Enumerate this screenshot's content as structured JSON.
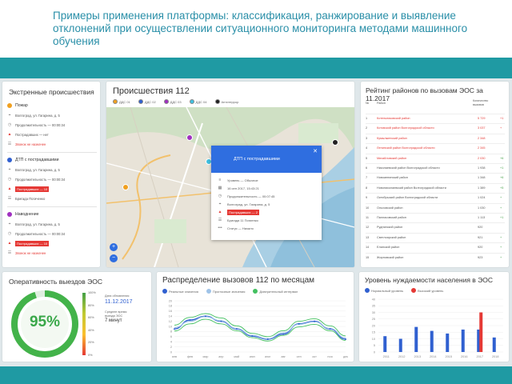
{
  "slide": {
    "title": "Примеры применения платформы: классификация, ранжирование и выявление отклонений при осуществлении ситуационного мониторинга методами машинного обучения"
  },
  "emergencies": {
    "title": "Экстренные происшествия",
    "incidents": [
      {
        "name": "Пожар",
        "color": "#f0a020",
        "address": "Волгоград, ул. Гагарина, д. 5",
        "duration": "Продолжительность — 00:00:34",
        "victims": "Пострадавших — нет",
        "status": "Звонок не назначен"
      },
      {
        "name": "ДТП с пострадавшими",
        "color": "#3060d0",
        "address": "Волгоград, ул. Гагарина, д. 5",
        "duration": "Продолжительность — 00:00:34",
        "victims": "Пострадавших — 10",
        "status": "Бригада Погиченко"
      },
      {
        "name": "Наводнение",
        "color": "#a030c0",
        "address": "Волгоград, ул. Гагарина, д. 5",
        "duration": "Продолжительность — 00:00:34",
        "victims": "Пострадавших — 10",
        "status": "Звонок не назначен"
      }
    ]
  },
  "map": {
    "title": "Происшествия 112",
    "legend": [
      {
        "label": "ДДС 01",
        "color": "#f0a020"
      },
      {
        "label": "ДДС 02",
        "color": "#3060d0"
      },
      {
        "label": "ДДС 03",
        "color": "#a030c0"
      },
      {
        "label": "ДДС 04",
        "color": "#40c0e0"
      },
      {
        "label": "Антитеррор",
        "color": "#222222"
      }
    ],
    "zoom_in": "+",
    "zoom_out": "−",
    "popup": {
      "title": "ДТП с пострадавшими",
      "close": "✕",
      "rows": [
        {
          "icon": "level-icon",
          "glyph": "≡",
          "text": "Уровень — Обычное"
        },
        {
          "icon": "calendar-icon",
          "glyph": "▦",
          "text": "16 сен 2017, 15:43:21"
        },
        {
          "icon": "clock-icon",
          "glyph": "◷",
          "text": "Продолжительность — 00:07:45"
        },
        {
          "icon": "location-icon",
          "glyph": "⌖",
          "text": "Волгоград, ул. Гагарина, д. 5"
        },
        {
          "icon": "warning-icon",
          "glyph": "▲",
          "text": "Пострадавших — 2",
          "alert": true
        },
        {
          "icon": "team-icon",
          "glyph": "☰",
          "text": "Бригада 11 Погиенко"
        },
        {
          "icon": "more-icon",
          "glyph": "•••",
          "text": "Статус — Начало"
        }
      ]
    }
  },
  "rating": {
    "title": "Рейтинг районов по вызовам ЭОС за 11.2017",
    "col_num": "№",
    "col_name": "Район",
    "col_value": "Количество вызовов",
    "rows": [
      {
        "num": "1",
        "name": "Котельниковский район",
        "value": "5 729",
        "delta": "+1",
        "red": true,
        "delta_color": "#e53935"
      },
      {
        "num": "2",
        "name": "Котовский район Волгоградской области",
        "value": "3 037",
        "delta": "+",
        "red": true,
        "delta_color": "#e53935"
      },
      {
        "num": "3",
        "name": "Кумылженский район",
        "value": "2 348",
        "delta": "",
        "red": true,
        "delta_color": "#e53935"
      },
      {
        "num": "4",
        "name": "Ленинский район Волгоградской области",
        "value": "2 345",
        "delta": "",
        "red": true,
        "delta_color": "#e53935"
      },
      {
        "num": "5",
        "name": "Михайловский район",
        "value": "2 030",
        "delta": "+6",
        "red": true,
        "delta_color": "#43a047"
      },
      {
        "num": "6",
        "name": "Николаевский район Волгоградской области",
        "value": "1 938",
        "delta": "+1",
        "red": false,
        "delta_color": "#43a047"
      },
      {
        "num": "7",
        "name": "Новоаннинский район",
        "value": "1 348",
        "delta": "+6",
        "red": false,
        "delta_color": "#43a047"
      },
      {
        "num": "8",
        "name": "Новониколаевский район Волгоградской области",
        "value": "1 389",
        "delta": "+5",
        "red": false,
        "delta_color": "#43a047"
      },
      {
        "num": "9",
        "name": "Октябрьский район Волгоградской области",
        "value": "1 024",
        "delta": "+",
        "red": false,
        "delta_color": "#43a047"
      },
      {
        "num": "10",
        "name": "Ольховский район",
        "value": "1 030",
        "delta": "+",
        "red": false,
        "delta_color": "#43a047"
      },
      {
        "num": "11",
        "name": "Палласовский район",
        "value": "1 113",
        "delta": "+1",
        "red": false,
        "delta_color": "#43a047"
      },
      {
        "num": "12",
        "name": "Руднянский район",
        "value": "920",
        "delta": "",
        "red": false,
        "delta_color": "#43a047"
      },
      {
        "num": "13",
        "name": "Светлоярский район",
        "value": "921",
        "delta": "+",
        "red": false,
        "delta_color": "#43a047"
      },
      {
        "num": "14",
        "name": "Еланский район",
        "value": "920",
        "delta": "+",
        "red": false,
        "delta_color": "#43a047"
      },
      {
        "num": "15",
        "name": "Жирновский район",
        "value": "923",
        "delta": "+",
        "red": false,
        "delta_color": "#43a047"
      }
    ]
  },
  "operations": {
    "title": "Оперативность выездов ЭОС",
    "percent": "95%",
    "percent_value": 0.95,
    "updated_label": "Дата обновления",
    "updated_value": "11.12.2017",
    "avg_label": "Среднее время выезда ЭОС",
    "avg_value": "7 минут",
    "scale_ticks": [
      "100%",
      "80%",
      "60%",
      "40%",
      "20%",
      "0%"
    ]
  },
  "monthly": {
    "title": "Распределение вызовов 112 по месяцам",
    "legend": [
      {
        "label": "Реальные значения",
        "color": "#3060d0"
      },
      {
        "label": "Прогнозные значения",
        "color": "#9fc3e8"
      },
      {
        "label": "Доверительный интервал",
        "color": "#43c060"
      }
    ]
  },
  "need": {
    "title": "Уровень нуждаемости населения в ЭОС",
    "legend": [
      {
        "label": "Нормальный уровень",
        "color": "#3060d0"
      },
      {
        "label": "Высокий уровень",
        "color": "#e53935"
      }
    ]
  },
  "chart_data": [
    {
      "type": "line",
      "title": "Распределение вызовов 112 по месяцам",
      "categories": [
        "янв",
        "фев",
        "мар",
        "апр",
        "май",
        "июн",
        "июл",
        "авг",
        "сен",
        "окт",
        "ноя",
        "дек"
      ],
      "y_ticks": [
        "20",
        "18",
        "16",
        "14",
        "12",
        "10",
        "8",
        "6",
        "4",
        "2",
        "0"
      ],
      "ylim": [
        0,
        20
      ],
      "series": [
        {
          "name": "Реальные значения",
          "values": [
            9,
            12.5,
            14,
            12,
            9,
            6.2,
            5,
            7,
            11,
            12,
            9,
            5
          ]
        },
        {
          "name": "Прогнозные значения",
          "values": [
            9.5,
            12,
            13.8,
            12.2,
            9.2,
            6.5,
            5.2,
            7.5,
            10.8,
            11.8,
            9.2,
            5.5
          ]
        },
        {
          "name": "Доверительный интервал",
          "values": [
            10.5,
            13.5,
            15,
            13.3,
            10.2,
            7.3,
            6,
            8.3,
            12,
            13,
            10.2,
            6.3
          ]
        },
        {
          "name": "Доверительный интервал",
          "values": [
            8.2,
            11,
            12.8,
            11,
            8.3,
            5.6,
            4.3,
            6.5,
            9.8,
            10.8,
            8.3,
            4.5
          ]
        }
      ],
      "grid": true
    },
    {
      "type": "bar",
      "title": "Уровень нуждаемости населения в ЭОС",
      "categories": [
        "2011",
        "2012",
        "2013",
        "2014",
        "2015",
        "2016",
        "2017",
        "2018"
      ],
      "y_ticks": [
        "40",
        "35",
        "30",
        "25",
        "20",
        "15",
        "10",
        "5",
        "0"
      ],
      "ylim": [
        0,
        40
      ],
      "series": [
        {
          "name": "Нормальный уровень",
          "values": [
            12,
            10,
            19,
            16,
            14,
            17,
            17,
            11
          ]
        },
        {
          "name": "Высокий уровень",
          "values": [
            0,
            0,
            0,
            0,
            0,
            0,
            30,
            0
          ]
        }
      ],
      "grid": true
    }
  ]
}
